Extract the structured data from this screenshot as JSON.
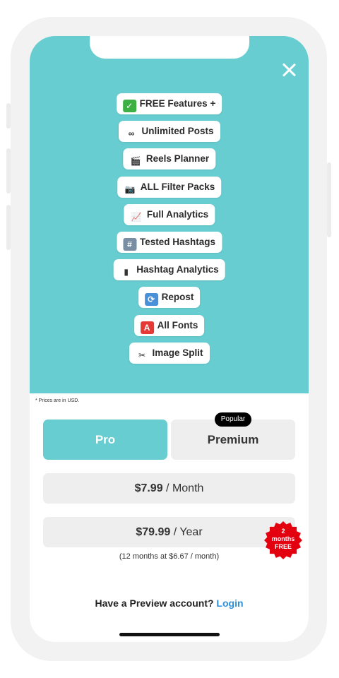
{
  "close_icon": "close-icon",
  "features": [
    {
      "emoji": "✓",
      "emoji_bg": "#3cb043",
      "label": "FREE Features +",
      "name": "feature-free"
    },
    {
      "emoji": "∞",
      "emoji_bg": "#ffffff",
      "label": "Unlimited Posts",
      "name": "feature-unlimited-posts"
    },
    {
      "emoji": "🎬",
      "emoji_bg": "#ffffff",
      "label": "Reels Planner",
      "name": "feature-reels-planner"
    },
    {
      "emoji": "📷",
      "emoji_bg": "#ffffff",
      "label": "ALL Filter Packs",
      "name": "feature-filter-packs"
    },
    {
      "emoji": "📈",
      "emoji_bg": "#ffffff",
      "label": "Full Analytics",
      "name": "feature-full-analytics"
    },
    {
      "emoji": "#",
      "emoji_bg": "#7a8ea3",
      "label": "Tested Hashtags",
      "name": "feature-tested-hashtags"
    },
    {
      "emoji": "▮",
      "emoji_bg": "#ffffff",
      "label": "Hashtag Analytics",
      "name": "feature-hashtag-analytics"
    },
    {
      "emoji": "⟳",
      "emoji_bg": "#4a90d9",
      "label": "Repost",
      "name": "feature-repost"
    },
    {
      "emoji": "A",
      "emoji_bg": "#e53935",
      "label": "All Fonts",
      "name": "feature-all-fonts"
    },
    {
      "emoji": "✂",
      "emoji_bg": "#ffffff",
      "label": "Image Split",
      "name": "feature-image-split"
    }
  ],
  "prices_note": "* Prices are in USD.",
  "tabs": {
    "pro": "Pro",
    "premium": "Premium",
    "popular_badge": "Popular"
  },
  "plans": {
    "monthly": {
      "amount": "$7.99",
      "period": " / Month"
    },
    "yearly": {
      "amount": "$79.99",
      "period": " / Year",
      "note": "(12 months at $6.67 / month)"
    }
  },
  "badge": {
    "line1": "2",
    "line2": "months",
    "line3": "FREE",
    "color": "#e3000f"
  },
  "footer": {
    "prompt": "Have a Preview account? ",
    "link": "Login"
  },
  "colors": {
    "accent": "#67cdd1",
    "link": "#2b8fdc"
  }
}
